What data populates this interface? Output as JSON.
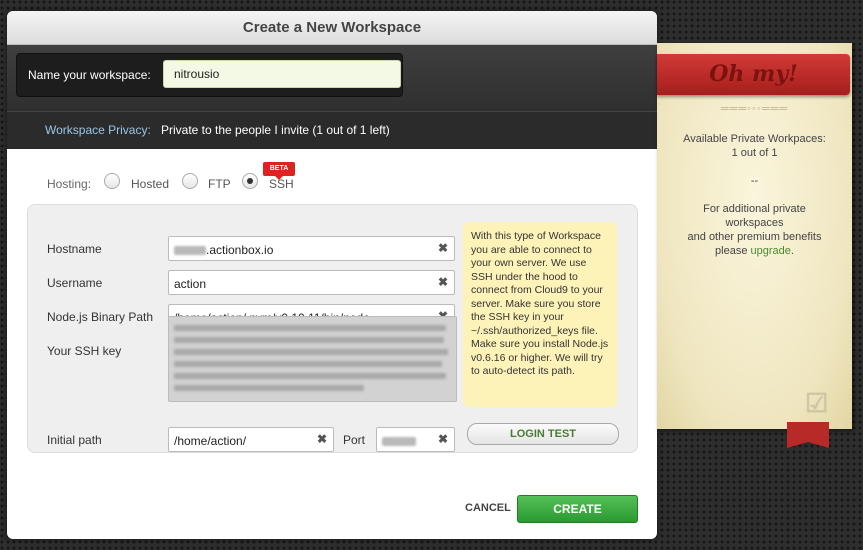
{
  "dialog": {
    "title": "Create a New Workspace",
    "name_label": "Name your workspace:",
    "name_value": "nitrousio",
    "privacy_label": "Workspace Privacy:",
    "privacy_value": "Private to the people I invite (1 out of 1 left)"
  },
  "hosting": {
    "label": "Hosting:",
    "options": [
      {
        "label": "Hosted",
        "selected": false
      },
      {
        "label": "FTP",
        "selected": false
      },
      {
        "label": "SSH",
        "selected": true
      }
    ],
    "badge": "BETA"
  },
  "form": {
    "hostname_label": "Hostname",
    "hostname_value": ".actionbox.io",
    "username_label": "Username",
    "username_value": "action",
    "node_label": "Node.js Binary Path",
    "node_value": "/home/action/.nvm/v0.10.11/bin/node",
    "sshkey_label": "Your SSH key",
    "initial_path_label": "Initial path",
    "initial_path_value": "/home/action/",
    "port_label": "Port"
  },
  "info_text": "With this type of Workspace you are able to connect to your own server. We use SSH under the hood to connect from Cloud9 to your server. Make sure you store the SSH key in your ~/.ssh/authorized_keys file. Make sure you install Node.js v0.6.16 or higher. We will try to auto-detect its path.",
  "buttons": {
    "login_test": "LOGIN TEST",
    "cancel": "CANCEL",
    "create": "CREATE",
    "clear_glyph": "✖"
  },
  "sidebar": {
    "ribbon": "Oh my!",
    "available_line1": "Available Private Workpaces:",
    "available_line2": "1 out of 1",
    "separator": "--",
    "promo_line1": "For additional private",
    "promo_line2": "workspaces",
    "promo_line3": "and other premium benefits",
    "promo_please": "please",
    "upgrade_link": "upgrade",
    "promo_end": "."
  },
  "colors": {
    "create_green": "#2a9a30",
    "ribbon_red": "#b82a27",
    "privacy_blue": "#9bc6e8",
    "info_yellow": "#fdf3b8"
  }
}
